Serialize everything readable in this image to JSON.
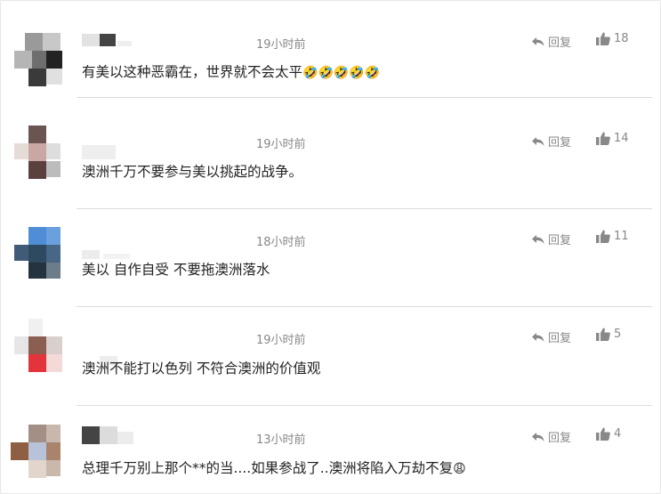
{
  "comments": [
    {
      "time": "19小时前",
      "reply_label": "回复",
      "likes": "18",
      "text": "有美以这种恶霸在，世界就不会太平",
      "emoji": "🤣🤣🤣🤣🤣"
    },
    {
      "time": "19小时前",
      "reply_label": "回复",
      "likes": "14",
      "text": "澳洲千万不要参与美以挑起的战争。",
      "emoji": ""
    },
    {
      "time": "18小时前",
      "reply_label": "回复",
      "likes": "11",
      "text": "美以 自作自受 不要拖澳洲落水",
      "emoji": ""
    },
    {
      "time": "19小时前",
      "reply_label": "回复",
      "likes": "5",
      "text": "澳洲不能打以色列 不符合澳洲的价值观",
      "emoji": ""
    },
    {
      "time": "13小时前",
      "reply_label": "回复",
      "likes": "4",
      "text": "总理千万别上那个**的当....如果参战了..澳洲将陷入万劫不复",
      "emoji": "😩"
    }
  ],
  "icons": {
    "reply": "reply-arrow-icon",
    "like": "thumbs-up-icon"
  },
  "colors": {
    "meta_text": "#888888",
    "body_text": "#222222",
    "divider": "#dcdcdc"
  }
}
